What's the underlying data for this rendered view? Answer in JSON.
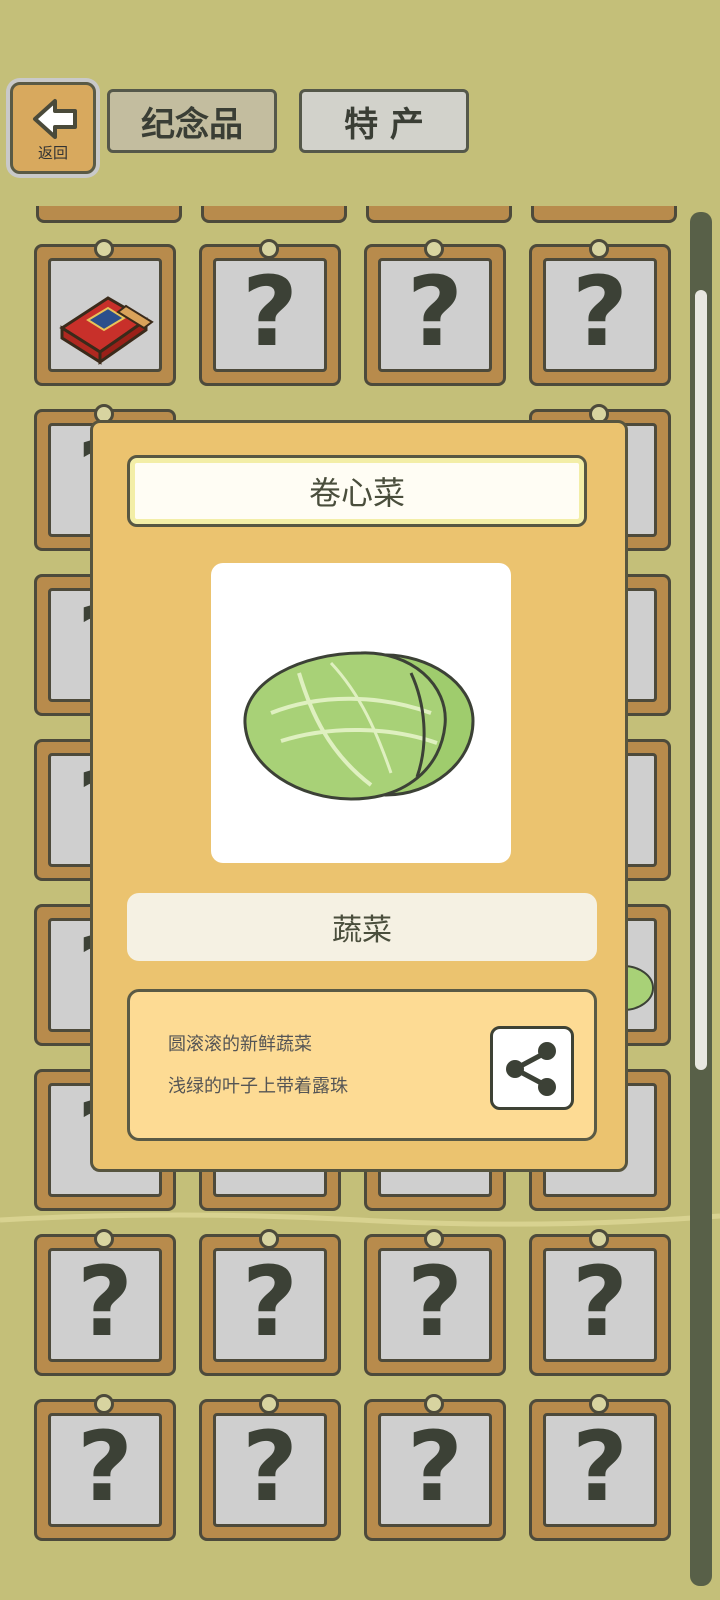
{
  "header": {
    "back_label": "返回",
    "tabs": [
      {
        "label": "纪念品",
        "active": true
      },
      {
        "label": "特 产",
        "active": false
      }
    ]
  },
  "grid": {
    "unknown_symbol": "?"
  },
  "popup": {
    "title": "卷心菜",
    "category": "蔬菜",
    "description_lines": [
      "圆滚滚的新鲜蔬菜",
      "浅绿的叶子上带着露珠"
    ],
    "item_icon": "cabbage-icon",
    "share_icon": "share-icon"
  },
  "colors": {
    "background": "#c4bf79",
    "modal": "#ebc36f",
    "tile_wood": "#b88b4c",
    "cabbage": "#a8d177"
  }
}
